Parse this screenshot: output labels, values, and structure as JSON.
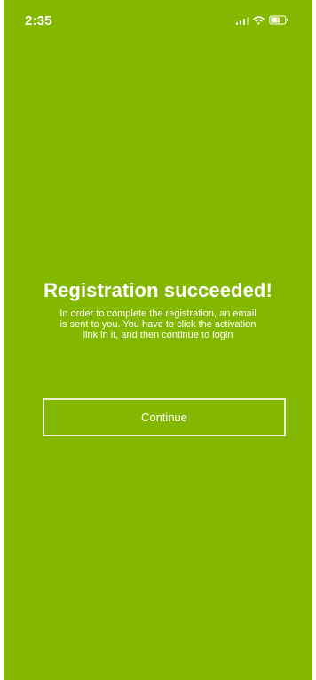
{
  "status_bar": {
    "time": "2:35",
    "signal_icon": "cellular-signal-icon",
    "wifi_icon": "wifi-icon",
    "battery_icon": "battery-charging-icon"
  },
  "registration": {
    "title": "Registration succeeded!",
    "message": "In order to complete the registration, an email is sent to you. You have to click the activation link in it, and then continue to login",
    "continue_label": "Continue"
  },
  "colors": {
    "background": "#84b800",
    "text": "#ffffff",
    "button_border": "#ffffff"
  }
}
